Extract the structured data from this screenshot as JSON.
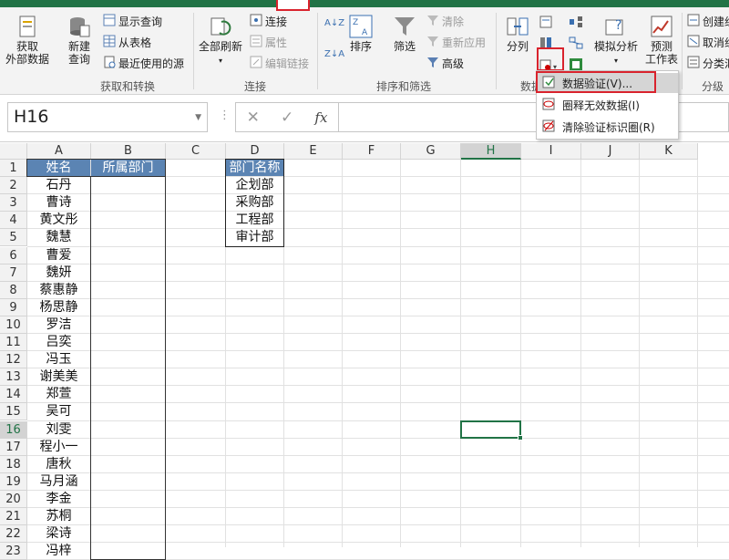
{
  "ribbon": {
    "groups": [
      {
        "label": "获取和转换"
      },
      {
        "label": "连接"
      },
      {
        "label": "排序和筛选"
      },
      {
        "label": "数据"
      },
      {
        "label": "分级"
      }
    ],
    "get_external": {
      "line1": "获取",
      "line2": "外部数据",
      "arrow": "▾"
    },
    "new_query": {
      "line1": "新建",
      "line2": "查询"
    },
    "show_query": "显示查询",
    "from_table": "从表格",
    "recent_sources": "最近使用的源",
    "refresh_all": {
      "label": "全部刷新"
    },
    "connections": "连接",
    "properties": "属性",
    "edit_links": "编辑链接",
    "sort_az": "A↓Z",
    "sort_za": "Z↓A",
    "sort": "排序",
    "filter": "筛选",
    "clear": "清除",
    "reapply": "重新应用",
    "advanced": "高级",
    "split": "分列",
    "what_if": "模拟分析",
    "forecast": {
      "line1": "预测",
      "line2": "工作表"
    },
    "create_group": "创建组",
    "ungroup": "取消组",
    "subtotal": "分类汇"
  },
  "dropdown_menu": {
    "items": [
      {
        "label": "数据验证(V)...",
        "highlighted": true
      },
      {
        "label": "圈释无效数据(I)",
        "highlighted": false
      },
      {
        "label": "清除验证标识圈(R)",
        "highlighted": false
      }
    ]
  },
  "formula_bar": {
    "name_box": "H16",
    "cancel": "✕",
    "enter": "✓",
    "fx": "fx",
    "value": ""
  },
  "sheet": {
    "columns": [
      "A",
      "B",
      "C",
      "D",
      "E",
      "F",
      "G",
      "H",
      "I",
      "J",
      "K"
    ],
    "selected_column": "H",
    "selected_row": "16",
    "rows": [
      "1",
      "2",
      "3",
      "4",
      "5",
      "6",
      "7",
      "8",
      "9",
      "10",
      "11",
      "12",
      "13",
      "14",
      "15",
      "16",
      "17",
      "18",
      "19",
      "20",
      "21",
      "22",
      "23"
    ],
    "header_a": "姓名",
    "header_b": "所属部门",
    "names": [
      "石丹",
      "曹诗",
      "黄文彤",
      "魏慧",
      "曹爱",
      "魏妍",
      "蔡惠静",
      "杨思静",
      "罗洁",
      "吕奕",
      "冯玉",
      "谢美美",
      "郑萱",
      "吴可",
      "刘雯",
      "程小一",
      "唐秋",
      "马月涵",
      "李金",
      "苏桐",
      "梁诗",
      "冯梓"
    ],
    "dept_header": "部门名称",
    "departments": [
      "企划部",
      "采购部",
      "工程部",
      "审计部"
    ]
  },
  "colors": {
    "accent": "#217346",
    "highlight": "#d9232d",
    "table_header": "#5b84b3"
  }
}
